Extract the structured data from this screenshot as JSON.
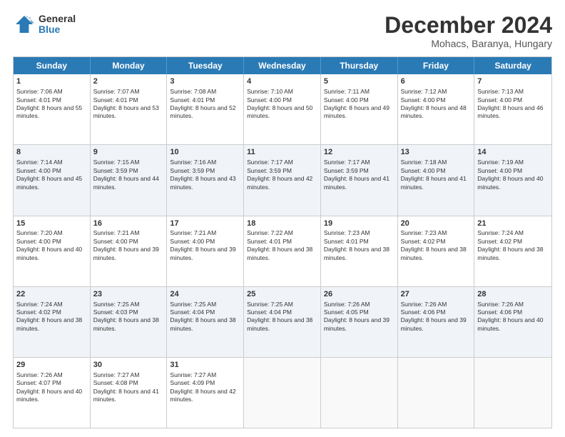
{
  "logo": {
    "general": "General",
    "blue": "Blue"
  },
  "title": "December 2024",
  "subtitle": "Mohacs, Baranya, Hungary",
  "days": [
    "Sunday",
    "Monday",
    "Tuesday",
    "Wednesday",
    "Thursday",
    "Friday",
    "Saturday"
  ],
  "weeks": [
    [
      {
        "day": "1",
        "sunrise": "Sunrise: 7:06 AM",
        "sunset": "Sunset: 4:01 PM",
        "daylight": "Daylight: 8 hours and 55 minutes."
      },
      {
        "day": "2",
        "sunrise": "Sunrise: 7:07 AM",
        "sunset": "Sunset: 4:01 PM",
        "daylight": "Daylight: 8 hours and 53 minutes."
      },
      {
        "day": "3",
        "sunrise": "Sunrise: 7:08 AM",
        "sunset": "Sunset: 4:01 PM",
        "daylight": "Daylight: 8 hours and 52 minutes."
      },
      {
        "day": "4",
        "sunrise": "Sunrise: 7:10 AM",
        "sunset": "Sunset: 4:00 PM",
        "daylight": "Daylight: 8 hours and 50 minutes."
      },
      {
        "day": "5",
        "sunrise": "Sunrise: 7:11 AM",
        "sunset": "Sunset: 4:00 PM",
        "daylight": "Daylight: 8 hours and 49 minutes."
      },
      {
        "day": "6",
        "sunrise": "Sunrise: 7:12 AM",
        "sunset": "Sunset: 4:00 PM",
        "daylight": "Daylight: 8 hours and 48 minutes."
      },
      {
        "day": "7",
        "sunrise": "Sunrise: 7:13 AM",
        "sunset": "Sunset: 4:00 PM",
        "daylight": "Daylight: 8 hours and 46 minutes."
      }
    ],
    [
      {
        "day": "8",
        "sunrise": "Sunrise: 7:14 AM",
        "sunset": "Sunset: 4:00 PM",
        "daylight": "Daylight: 8 hours and 45 minutes."
      },
      {
        "day": "9",
        "sunrise": "Sunrise: 7:15 AM",
        "sunset": "Sunset: 3:59 PM",
        "daylight": "Daylight: 8 hours and 44 minutes."
      },
      {
        "day": "10",
        "sunrise": "Sunrise: 7:16 AM",
        "sunset": "Sunset: 3:59 PM",
        "daylight": "Daylight: 8 hours and 43 minutes."
      },
      {
        "day": "11",
        "sunrise": "Sunrise: 7:17 AM",
        "sunset": "Sunset: 3:59 PM",
        "daylight": "Daylight: 8 hours and 42 minutes."
      },
      {
        "day": "12",
        "sunrise": "Sunrise: 7:17 AM",
        "sunset": "Sunset: 3:59 PM",
        "daylight": "Daylight: 8 hours and 41 minutes."
      },
      {
        "day": "13",
        "sunrise": "Sunrise: 7:18 AM",
        "sunset": "Sunset: 4:00 PM",
        "daylight": "Daylight: 8 hours and 41 minutes."
      },
      {
        "day": "14",
        "sunrise": "Sunrise: 7:19 AM",
        "sunset": "Sunset: 4:00 PM",
        "daylight": "Daylight: 8 hours and 40 minutes."
      }
    ],
    [
      {
        "day": "15",
        "sunrise": "Sunrise: 7:20 AM",
        "sunset": "Sunset: 4:00 PM",
        "daylight": "Daylight: 8 hours and 40 minutes."
      },
      {
        "day": "16",
        "sunrise": "Sunrise: 7:21 AM",
        "sunset": "Sunset: 4:00 PM",
        "daylight": "Daylight: 8 hours and 39 minutes."
      },
      {
        "day": "17",
        "sunrise": "Sunrise: 7:21 AM",
        "sunset": "Sunset: 4:00 PM",
        "daylight": "Daylight: 8 hours and 39 minutes."
      },
      {
        "day": "18",
        "sunrise": "Sunrise: 7:22 AM",
        "sunset": "Sunset: 4:01 PM",
        "daylight": "Daylight: 8 hours and 38 minutes."
      },
      {
        "day": "19",
        "sunrise": "Sunrise: 7:23 AM",
        "sunset": "Sunset: 4:01 PM",
        "daylight": "Daylight: 8 hours and 38 minutes."
      },
      {
        "day": "20",
        "sunrise": "Sunrise: 7:23 AM",
        "sunset": "Sunset: 4:02 PM",
        "daylight": "Daylight: 8 hours and 38 minutes."
      },
      {
        "day": "21",
        "sunrise": "Sunrise: 7:24 AM",
        "sunset": "Sunset: 4:02 PM",
        "daylight": "Daylight: 8 hours and 38 minutes."
      }
    ],
    [
      {
        "day": "22",
        "sunrise": "Sunrise: 7:24 AM",
        "sunset": "Sunset: 4:02 PM",
        "daylight": "Daylight: 8 hours and 38 minutes."
      },
      {
        "day": "23",
        "sunrise": "Sunrise: 7:25 AM",
        "sunset": "Sunset: 4:03 PM",
        "daylight": "Daylight: 8 hours and 38 minutes."
      },
      {
        "day": "24",
        "sunrise": "Sunrise: 7:25 AM",
        "sunset": "Sunset: 4:04 PM",
        "daylight": "Daylight: 8 hours and 38 minutes."
      },
      {
        "day": "25",
        "sunrise": "Sunrise: 7:25 AM",
        "sunset": "Sunset: 4:04 PM",
        "daylight": "Daylight: 8 hours and 38 minutes."
      },
      {
        "day": "26",
        "sunrise": "Sunrise: 7:26 AM",
        "sunset": "Sunset: 4:05 PM",
        "daylight": "Daylight: 8 hours and 39 minutes."
      },
      {
        "day": "27",
        "sunrise": "Sunrise: 7:26 AM",
        "sunset": "Sunset: 4:06 PM",
        "daylight": "Daylight: 8 hours and 39 minutes."
      },
      {
        "day": "28",
        "sunrise": "Sunrise: 7:26 AM",
        "sunset": "Sunset: 4:06 PM",
        "daylight": "Daylight: 8 hours and 40 minutes."
      }
    ],
    [
      {
        "day": "29",
        "sunrise": "Sunrise: 7:26 AM",
        "sunset": "Sunset: 4:07 PM",
        "daylight": "Daylight: 8 hours and 40 minutes."
      },
      {
        "day": "30",
        "sunrise": "Sunrise: 7:27 AM",
        "sunset": "Sunset: 4:08 PM",
        "daylight": "Daylight: 8 hours and 41 minutes."
      },
      {
        "day": "31",
        "sunrise": "Sunrise: 7:27 AM",
        "sunset": "Sunset: 4:09 PM",
        "daylight": "Daylight: 8 hours and 42 minutes."
      },
      null,
      null,
      null,
      null
    ]
  ],
  "colors": {
    "header_bg": "#2a7ab5",
    "alt_row": "#eef3f8",
    "empty": "#f9f9f9"
  }
}
